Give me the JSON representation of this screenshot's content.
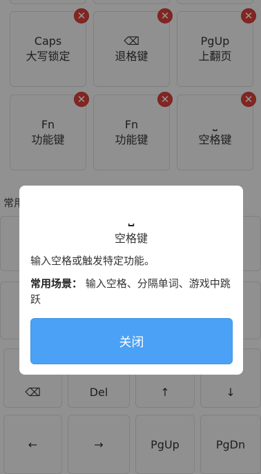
{
  "colors": {
    "accent": "#4aa1f5",
    "delete_badge": "#d8403a",
    "background": "#f2f2f2"
  },
  "key_cards": [
    {
      "line1": "Caps",
      "line2": "大写锁定"
    },
    {
      "line1": "⌫",
      "line2": "退格键"
    },
    {
      "line1": "PgUp",
      "line2": "上翻页"
    },
    {
      "line1": "Fn",
      "line2": "功能键"
    },
    {
      "line1": "Fn",
      "line2": "功能键"
    },
    {
      "line1": "⎵",
      "line2": "空格键"
    }
  ],
  "delete_badge_glyph": "✕",
  "section": {
    "label": "常用"
  },
  "keyboard_rows": {
    "row_a": [
      "⌫",
      "Del",
      "↑",
      "↓"
    ],
    "row_b": [
      "←",
      "→",
      "PgUp",
      "PgDn"
    ]
  },
  "dialog": {
    "icon": "⎵",
    "title": "空格键",
    "description": "输入空格或触发特定功能。",
    "usage_label": "常用场景：",
    "usage_text": "输入空格、分隔单词、游戏中跳跃",
    "close_label": "关闭"
  }
}
